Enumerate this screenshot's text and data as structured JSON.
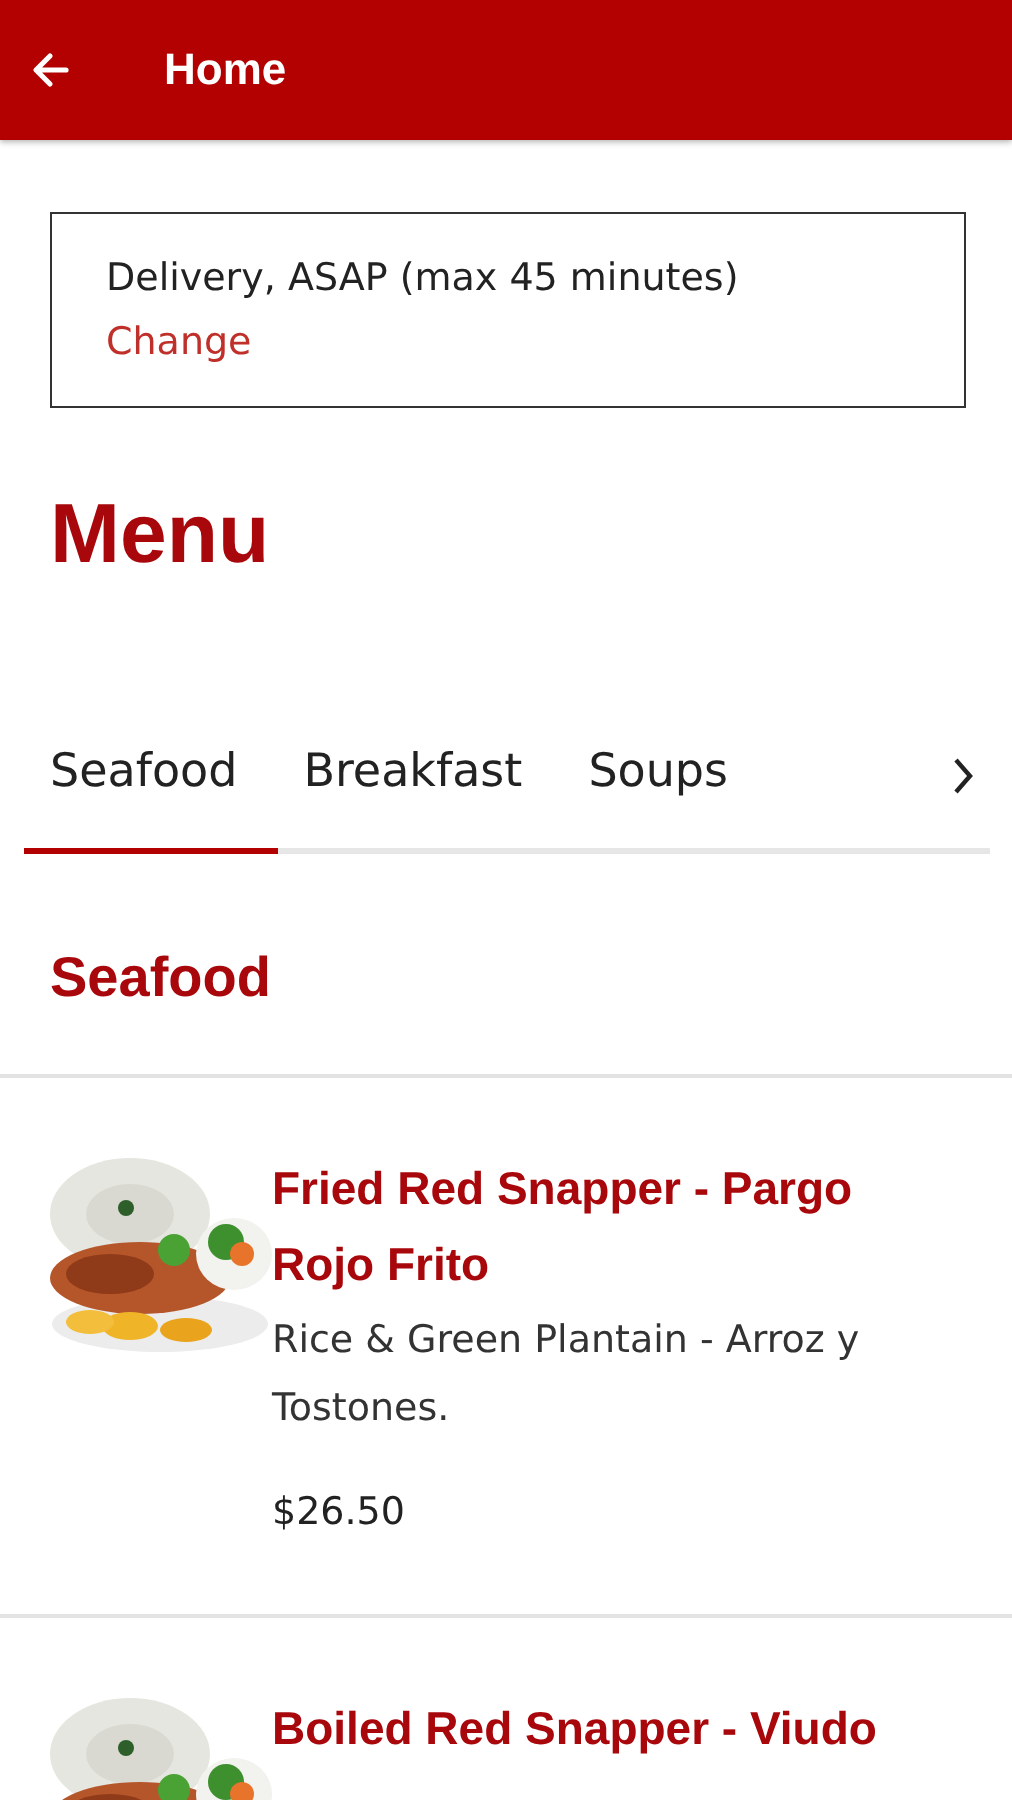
{
  "app_bar": {
    "back_icon": true,
    "title": "Home"
  },
  "delivery": {
    "text": "Delivery, ASAP (max 45 minutes)",
    "link": "Change"
  },
  "heading": "Menu",
  "tabs": [
    {
      "label": "Seafood",
      "selected": true
    },
    {
      "label": "Breakfast",
      "selected": false
    },
    {
      "label": "Soups",
      "selected": false
    }
  ],
  "tabs_more": true,
  "section_title": "Seafood",
  "items": [
    {
      "name": "Fried Red Snapper - Pargo Rojo Frito",
      "description": "Rice & Green Plantain - Arroz y Tostones.",
      "price": "$26.50"
    },
    {
      "name": "Boiled Red Snapper - Viudo"
    }
  ]
}
